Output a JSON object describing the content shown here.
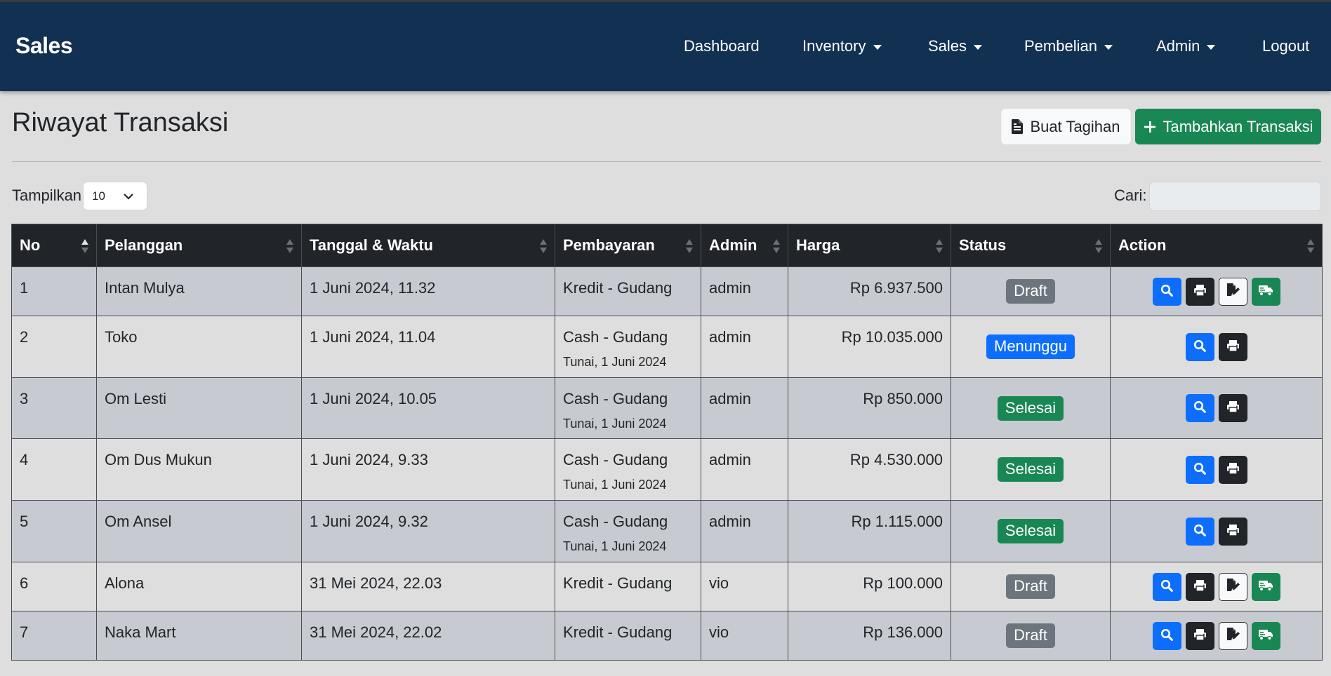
{
  "app": {
    "brand": "Sales"
  },
  "nav": [
    {
      "label": "Dashboard",
      "dropdown": false
    },
    {
      "label": "Inventory",
      "dropdown": true
    },
    {
      "label": "Sales",
      "dropdown": true
    },
    {
      "label": "Pembelian",
      "dropdown": true
    },
    {
      "label": "Admin",
      "dropdown": true
    },
    {
      "label": "Logout",
      "dropdown": false
    }
  ],
  "page": {
    "title": "Riwayat Transaksi",
    "buat_tagihan": "Buat Tagihan",
    "tambah_transaksi": "Tambahkan Transaksi"
  },
  "controls": {
    "length_label": "Tampilkan",
    "length_value": "10",
    "search_label": "Cari:",
    "search_value": ""
  },
  "table": {
    "columns": [
      "No",
      "Pelanggan",
      "Tanggal & Waktu",
      "Pembayaran",
      "Admin",
      "Harga",
      "Status",
      "Action"
    ],
    "rows": [
      {
        "no": "1",
        "pelanggan": "Intan Mulya",
        "tanggal": "1 Juni 2024, 11.32",
        "pembayaran": "Kredit - Gudang",
        "pembayaran_sub": "",
        "admin": "admin",
        "harga": "Rp 6.937.500",
        "status": "Draft",
        "status_type": "draft"
      },
      {
        "no": "2",
        "pelanggan": "Toko",
        "tanggal": "1 Juni 2024, 11.04",
        "pembayaran": "Cash - Gudang",
        "pembayaran_sub": "Tunai, 1 Juni 2024",
        "admin": "admin",
        "harga": "Rp 10.035.000",
        "status": "Menunggu",
        "status_type": "wait"
      },
      {
        "no": "3",
        "pelanggan": "Om Lesti",
        "tanggal": "1 Juni 2024, 10.05",
        "pembayaran": "Cash - Gudang",
        "pembayaran_sub": "Tunai, 1 Juni 2024",
        "admin": "admin",
        "harga": "Rp 850.000",
        "status": "Selesai",
        "status_type": "done"
      },
      {
        "no": "4",
        "pelanggan": "Om Dus Mukun",
        "tanggal": "1 Juni 2024, 9.33",
        "pembayaran": "Cash - Gudang",
        "pembayaran_sub": "Tunai, 1 Juni 2024",
        "admin": "admin",
        "harga": "Rp 4.530.000",
        "status": "Selesai",
        "status_type": "done"
      },
      {
        "no": "5",
        "pelanggan": "Om Ansel",
        "tanggal": "1 Juni 2024, 9.32",
        "pembayaran": "Cash - Gudang",
        "pembayaran_sub": "Tunai, 1 Juni 2024",
        "admin": "admin",
        "harga": "Rp 1.115.000",
        "status": "Selesai",
        "status_type": "done"
      },
      {
        "no": "6",
        "pelanggan": "Alona",
        "tanggal": "31 Mei 2024, 22.03",
        "pembayaran": "Kredit - Gudang",
        "pembayaran_sub": "",
        "admin": "vio",
        "harga": "Rp 100.000",
        "status": "Draft",
        "status_type": "draft"
      },
      {
        "no": "7",
        "pelanggan": "Naka Mart",
        "tanggal": "31 Mei 2024, 22.02",
        "pembayaran": "Kredit - Gudang",
        "pembayaran_sub": "",
        "admin": "vio",
        "harga": "Rp 136.000",
        "status": "Draft",
        "status_type": "draft"
      }
    ]
  },
  "colors": {
    "navbar": "#123152",
    "success": "#198754",
    "primary": "#0d6efd",
    "secondary": "#6c757d",
    "dark": "#212529"
  }
}
